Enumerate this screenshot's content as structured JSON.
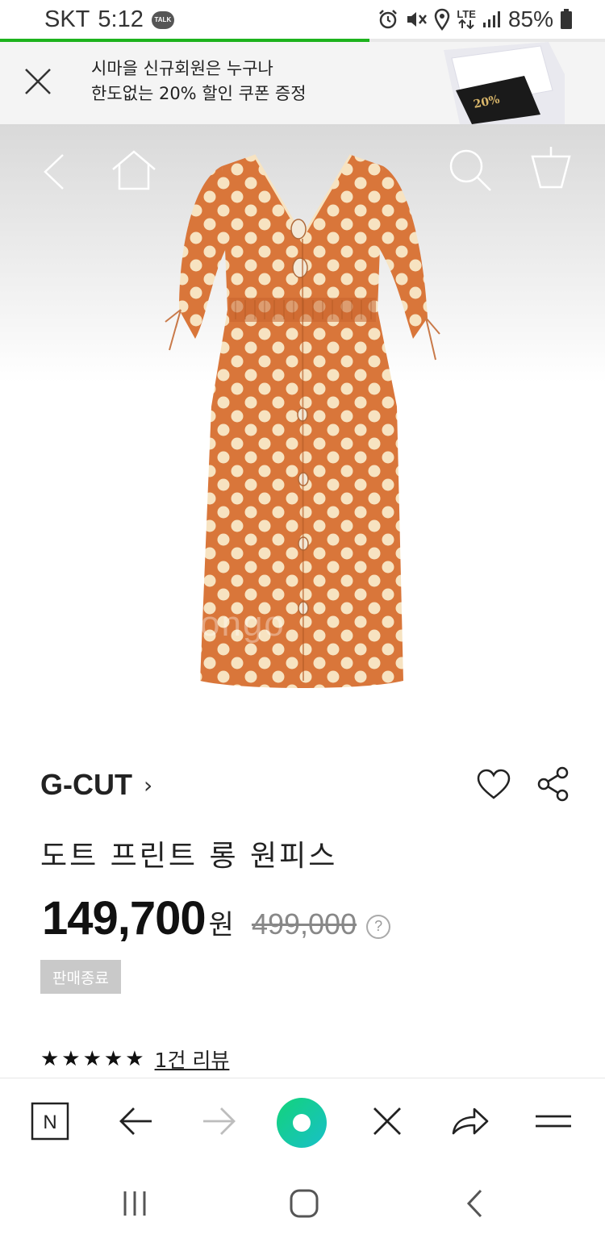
{
  "status_bar": {
    "carrier": "SKT",
    "time": "5:12",
    "talk_badge": "TALK",
    "network": "LTE",
    "battery": "85%",
    "icons": [
      "alarm-icon",
      "mute-icon",
      "location-icon",
      "lte-icon",
      "signal-icon",
      "battery-icon"
    ]
  },
  "page_load_progress": 0.61,
  "promo": {
    "line1": "시마을 신규회원은 누구나",
    "line2": "한도없는 20% 할인 쿠폰 증정",
    "card_percent": "20%"
  },
  "hero": {
    "watermark": "ongo",
    "nav_icons": [
      "back-icon",
      "home-icon",
      "search-icon",
      "cart-icon"
    ]
  },
  "product": {
    "brand": "G-CUT",
    "brand_chevron": "›",
    "title": "도트 프린트 롱 원피스",
    "price": "149,700",
    "price_unit": "원",
    "original_price": "499,000",
    "help": "?",
    "sold_out": "판매종료",
    "rating": 5,
    "stars": "★★★★★",
    "review_count": "1건 리뷰"
  },
  "toolbar": {
    "logo_letter": "N",
    "icons": [
      "naver-logo-icon",
      "back-arrow-icon",
      "forward-arrow-icon",
      "green-dot-icon",
      "close-icon",
      "share-arrow-icon",
      "menu-icon"
    ]
  },
  "colors": {
    "accent_green": "#1db31d",
    "dress_orange": "#d9763a",
    "dot_cream": "#f7e3c1",
    "soldout_gray": "#c9c9c9"
  }
}
